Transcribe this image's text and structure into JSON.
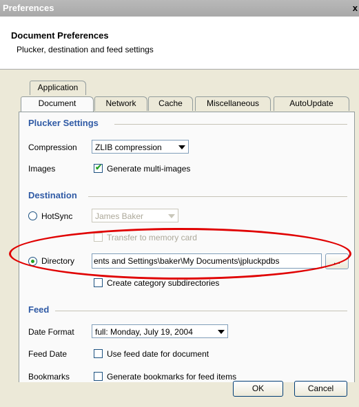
{
  "window": {
    "title": "Preferences",
    "close": "x"
  },
  "header": {
    "title": "Document Preferences",
    "subtitle": "Plucker, destination and feed settings"
  },
  "tabs": {
    "row1": [
      "Application"
    ],
    "row2": [
      "Document",
      "Network",
      "Cache",
      "Miscellaneous",
      "AutoUpdate"
    ],
    "active": "Document"
  },
  "plucker": {
    "section": "Plucker Settings",
    "compression_label": "Compression",
    "compression_value": "ZLIB compression",
    "images_label": "Images",
    "images_option": "Generate multi-images",
    "images_checked": true
  },
  "destination": {
    "section": "Destination",
    "hotsync_label": "HotSync",
    "hotsync_user": "James Baker",
    "transfer_label": "Transfer to memory card",
    "directory_label": "Directory",
    "directory_value": "ents and Settings\\baker\\My Documents\\jpluckpdbs",
    "browse_label": "...",
    "subdirs_label": "Create category subdirectories",
    "selected": "Directory"
  },
  "feed": {
    "section": "Feed",
    "date_format_label": "Date Format",
    "date_format_value": "full: Monday, July 19, 2004",
    "feed_date_label": "Feed Date",
    "feed_date_option": "Use feed date for document",
    "bookmarks_label": "Bookmarks",
    "bookmarks_option": "Generate bookmarks for feed items"
  },
  "buttons": {
    "ok": "OK",
    "cancel": "Cancel"
  },
  "colors": {
    "section": "#2f5aa5",
    "highlight_ellipse": "#e00000",
    "dialog_bg": "#ece9d8"
  }
}
